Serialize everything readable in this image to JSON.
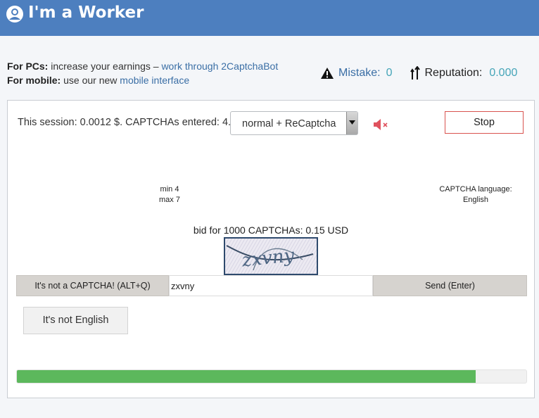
{
  "header": {
    "title": "I'm a Worker",
    "icon": "worker-icon",
    "background_color": "#4d7fbf"
  },
  "info": {
    "pc_label": "For PCs:",
    "pc_text": "increase your earnings –",
    "pc_link": "work through 2CaptchaBot",
    "mobile_label": "For mobile:",
    "mobile_text": "use our new",
    "mobile_link": "mobile interface"
  },
  "stats": {
    "mistake_label": "Mistake:",
    "mistake_value": "0",
    "reputation_label": "Reputation:",
    "reputation_value": "0.000"
  },
  "session": {
    "text": "This session: 0.0012 $. CAPTCHAs entered: 4.",
    "mode_selected": "normal + ReCaptcha",
    "sound": "muted",
    "stop_label": "Stop"
  },
  "captcha": {
    "min": "min 4",
    "max": "max 7",
    "language_label": "CAPTCHA language:",
    "language": "English",
    "bid_text": "bid for 1000 CAPTCHAs: 0.15 USD",
    "image_text": "zxvny",
    "not_captcha_label": "It's not a CAPTCHA! (ALT+Q)",
    "answer_value": "zxvny",
    "send_label": "Send (Enter)",
    "not_english_label": "It's not English"
  },
  "progress": {
    "fraction": 0.9,
    "color": "#5cb85c"
  }
}
